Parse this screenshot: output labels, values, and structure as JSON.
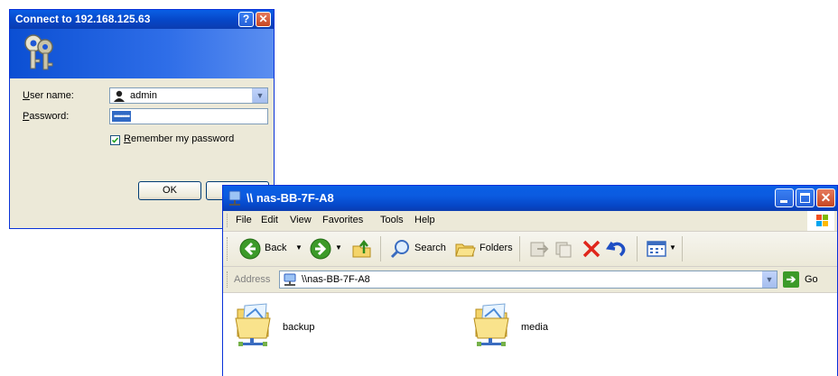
{
  "login_dialog": {
    "title": "Connect to 192.168.125.63",
    "help_button": "?",
    "close_button": "✕",
    "username_label_accel": "U",
    "username_label_rest": "ser name:",
    "username_value": "admin",
    "password_label_accel": "P",
    "password_label_rest": "assword:",
    "password_mask": "••••••••",
    "remember_label_accel": "R",
    "remember_label_rest": "emember my password",
    "remember_checked": true,
    "ok_label": "OK"
  },
  "explorer": {
    "title": "\\\\ nas-BB-7F-A8",
    "menu": {
      "file": "File",
      "edit": "Edit",
      "view": "View",
      "favorites": "Favorites",
      "tools": "Tools",
      "help": "Help"
    },
    "toolbar": {
      "back": "Back",
      "search": "Search",
      "folders": "Folders"
    },
    "address": {
      "label": "Address",
      "value": "\\\\nas-BB-7F-A8",
      "go": "Go"
    },
    "shares": [
      "backup",
      "media"
    ]
  },
  "colors": {
    "titlebar_blue": "#0646c7",
    "xp_face": "#ece9d8",
    "close_red": "#c64621",
    "go_green": "#3c9a29"
  }
}
